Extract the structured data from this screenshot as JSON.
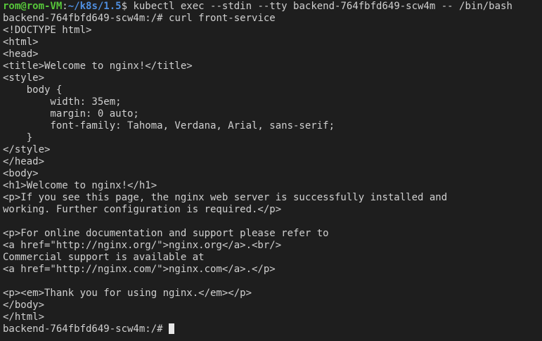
{
  "terminal": {
    "first_prompt": {
      "user_host": "rom@rom-VM",
      "separator": ":",
      "cwd": "~/k8s/1.5",
      "symbol": "$ ",
      "command": "kubectl exec --stdin --tty backend-764fbfd649-scw4m -- /bin/bash"
    },
    "second_prompt": {
      "prompt": "backend-764fbfd649-scw4m:/# ",
      "command": "curl front-service"
    },
    "output_lines": [
      "<!DOCTYPE html>",
      "<html>",
      "<head>",
      "<title>Welcome to nginx!</title>",
      "<style>",
      "    body {",
      "        width: 35em;",
      "        margin: 0 auto;",
      "        font-family: Tahoma, Verdana, Arial, sans-serif;",
      "    }",
      "</style>",
      "</head>",
      "<body>",
      "<h1>Welcome to nginx!</h1>",
      "<p>If you see this page, the nginx web server is successfully installed and",
      "working. Further configuration is required.</p>",
      "",
      "<p>For online documentation and support please refer to",
      "<a href=\"http://nginx.org/\">nginx.org</a>.<br/>",
      "Commercial support is available at",
      "<a href=\"http://nginx.com/\">nginx.com</a>.</p>",
      "",
      "<p><em>Thank you for using nginx.</em></p>",
      "</body>",
      "</html>"
    ],
    "final_prompt": {
      "prompt": "backend-764fbfd649-scw4m:/# "
    }
  }
}
